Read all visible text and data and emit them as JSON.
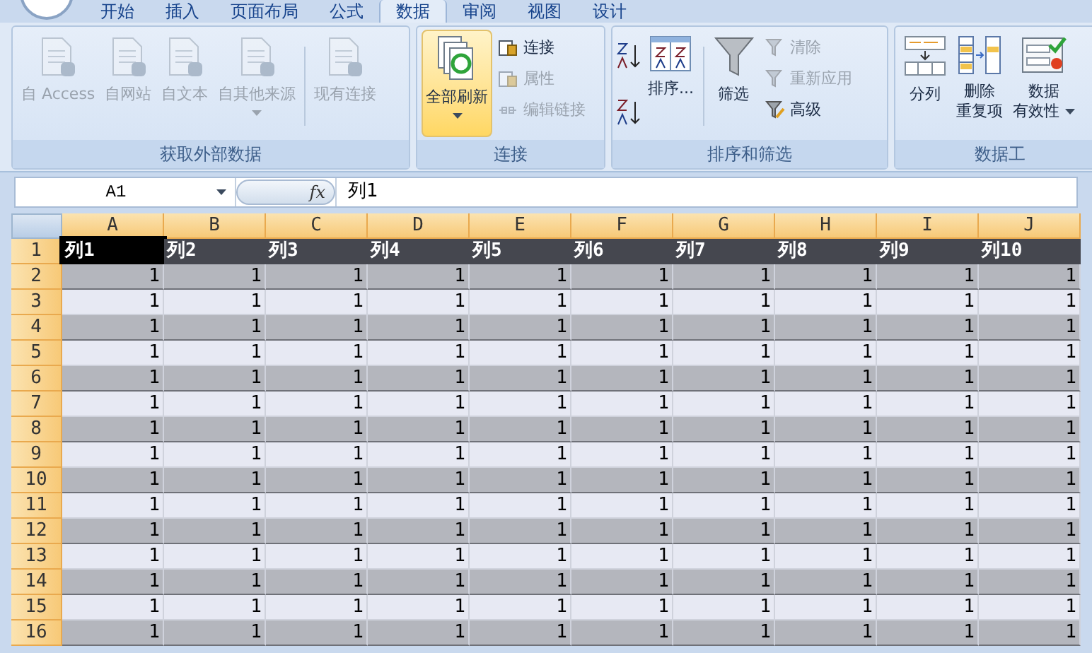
{
  "ribbon_tabs": [
    {
      "label": "开始",
      "selected": false
    },
    {
      "label": "插入",
      "selected": false
    },
    {
      "label": "页面布局",
      "selected": false
    },
    {
      "label": "公式",
      "selected": false
    },
    {
      "label": "数据",
      "selected": true
    },
    {
      "label": "审阅",
      "selected": false
    },
    {
      "label": "视图",
      "selected": false
    },
    {
      "label": "设计",
      "selected": false
    }
  ],
  "ribbon_groups": [
    {
      "title": "获取外部数据",
      "buttons": [
        {
          "kind": "large",
          "label": "自 Access",
          "disabled": true,
          "highlighted": false,
          "dropdown": false
        },
        {
          "kind": "large",
          "label": "自网站",
          "disabled": true,
          "highlighted": false,
          "dropdown": false
        },
        {
          "kind": "large",
          "label": "自文本",
          "disabled": true,
          "highlighted": false,
          "dropdown": false
        },
        {
          "kind": "large",
          "label": "自其他来源",
          "disabled": true,
          "highlighted": false,
          "dropdown": true
        },
        {
          "kind": "separator"
        },
        {
          "kind": "large",
          "label": "现有连接",
          "disabled": true,
          "highlighted": false,
          "dropdown": false
        }
      ]
    },
    {
      "title": "连接",
      "buttons": [
        {
          "kind": "large",
          "label": "全部刷新",
          "disabled": false,
          "highlighted": true,
          "dropdown": true
        },
        {
          "kind": "small",
          "label": "连接",
          "disabled": false,
          "highlighted": false,
          "dropdown": false
        },
        {
          "kind": "small",
          "label": "属性",
          "disabled": true,
          "highlighted": false,
          "dropdown": false
        },
        {
          "kind": "small",
          "label": "编辑链接",
          "disabled": true,
          "highlighted": false,
          "dropdown": false
        }
      ]
    },
    {
      "title": "排序和筛选",
      "buttons": [
        {
          "kind": "sort_pair"
        },
        {
          "kind": "large",
          "label": "排序...",
          "disabled": false,
          "highlighted": false,
          "dropdown": false
        },
        {
          "kind": "separator"
        },
        {
          "kind": "large",
          "label": "筛选",
          "disabled": false,
          "highlighted": false,
          "dropdown": false
        },
        {
          "kind": "small",
          "label": "清除",
          "disabled": true,
          "highlighted": false,
          "dropdown": false
        },
        {
          "kind": "small",
          "label": "重新应用",
          "disabled": true,
          "highlighted": false,
          "dropdown": false
        },
        {
          "kind": "small",
          "label": "高级",
          "disabled": false,
          "highlighted": false,
          "dropdown": false
        }
      ]
    },
    {
      "title": "数据工",
      "buttons": [
        {
          "kind": "large",
          "label": "分列",
          "disabled": false,
          "highlighted": false,
          "dropdown": false
        },
        {
          "kind": "large2",
          "label": "删除",
          "label2": "重复项",
          "disabled": false,
          "highlighted": false,
          "dropdown": false
        },
        {
          "kind": "large2",
          "label": "数据",
          "label2": "有效性",
          "disabled": false,
          "highlighted": false,
          "dropdown": true
        }
      ]
    }
  ],
  "formula_bar": {
    "name_box": "A1",
    "fx": "fx",
    "value": "列1"
  },
  "sheet": {
    "columns": [
      "A",
      "B",
      "C",
      "D",
      "E",
      "F",
      "G",
      "H",
      "I",
      "J"
    ],
    "header_row": {
      "number": "1",
      "cells": [
        {
          "text": "列1",
          "selected": true
        },
        {
          "text": "列2",
          "selected": false
        },
        {
          "text": "列3",
          "selected": false
        },
        {
          "text": "列4",
          "selected": false
        },
        {
          "text": "列5",
          "selected": false
        },
        {
          "text": "列6",
          "selected": false
        },
        {
          "text": "列7",
          "selected": false
        },
        {
          "text": "列8",
          "selected": false
        },
        {
          "text": "列9",
          "selected": false
        },
        {
          "text": "列10",
          "selected": false
        }
      ]
    },
    "rows": [
      {
        "number": "2",
        "cells": [
          "1",
          "1",
          "1",
          "1",
          "1",
          "1",
          "1",
          "1",
          "1",
          "1"
        ]
      },
      {
        "number": "3",
        "cells": [
          "1",
          "1",
          "1",
          "1",
          "1",
          "1",
          "1",
          "1",
          "1",
          "1"
        ]
      },
      {
        "number": "4",
        "cells": [
          "1",
          "1",
          "1",
          "1",
          "1",
          "1",
          "1",
          "1",
          "1",
          "1"
        ]
      },
      {
        "number": "5",
        "cells": [
          "1",
          "1",
          "1",
          "1",
          "1",
          "1",
          "1",
          "1",
          "1",
          "1"
        ]
      },
      {
        "number": "6",
        "cells": [
          "1",
          "1",
          "1",
          "1",
          "1",
          "1",
          "1",
          "1",
          "1",
          "1"
        ]
      },
      {
        "number": "7",
        "cells": [
          "1",
          "1",
          "1",
          "1",
          "1",
          "1",
          "1",
          "1",
          "1",
          "1"
        ]
      },
      {
        "number": "8",
        "cells": [
          "1",
          "1",
          "1",
          "1",
          "1",
          "1",
          "1",
          "1",
          "1",
          "1"
        ]
      },
      {
        "number": "9",
        "cells": [
          "1",
          "1",
          "1",
          "1",
          "1",
          "1",
          "1",
          "1",
          "1",
          "1"
        ]
      },
      {
        "number": "10",
        "cells": [
          "1",
          "1",
          "1",
          "1",
          "1",
          "1",
          "1",
          "1",
          "1",
          "1"
        ]
      },
      {
        "number": "11",
        "cells": [
          "1",
          "1",
          "1",
          "1",
          "1",
          "1",
          "1",
          "1",
          "1",
          "1"
        ]
      },
      {
        "number": "12",
        "cells": [
          "1",
          "1",
          "1",
          "1",
          "1",
          "1",
          "1",
          "1",
          "1",
          "1"
        ]
      },
      {
        "number": "13",
        "cells": [
          "1",
          "1",
          "1",
          "1",
          "1",
          "1",
          "1",
          "1",
          "1",
          "1"
        ]
      },
      {
        "number": "14",
        "cells": [
          "1",
          "1",
          "1",
          "1",
          "1",
          "1",
          "1",
          "1",
          "1",
          "1"
        ]
      },
      {
        "number": "15",
        "cells": [
          "1",
          "1",
          "1",
          "1",
          "1",
          "1",
          "1",
          "1",
          "1",
          "1"
        ]
      },
      {
        "number": "16",
        "cells": [
          "1",
          "1",
          "1",
          "1",
          "1",
          "1",
          "1",
          "1",
          "1",
          "1"
        ]
      }
    ]
  }
}
